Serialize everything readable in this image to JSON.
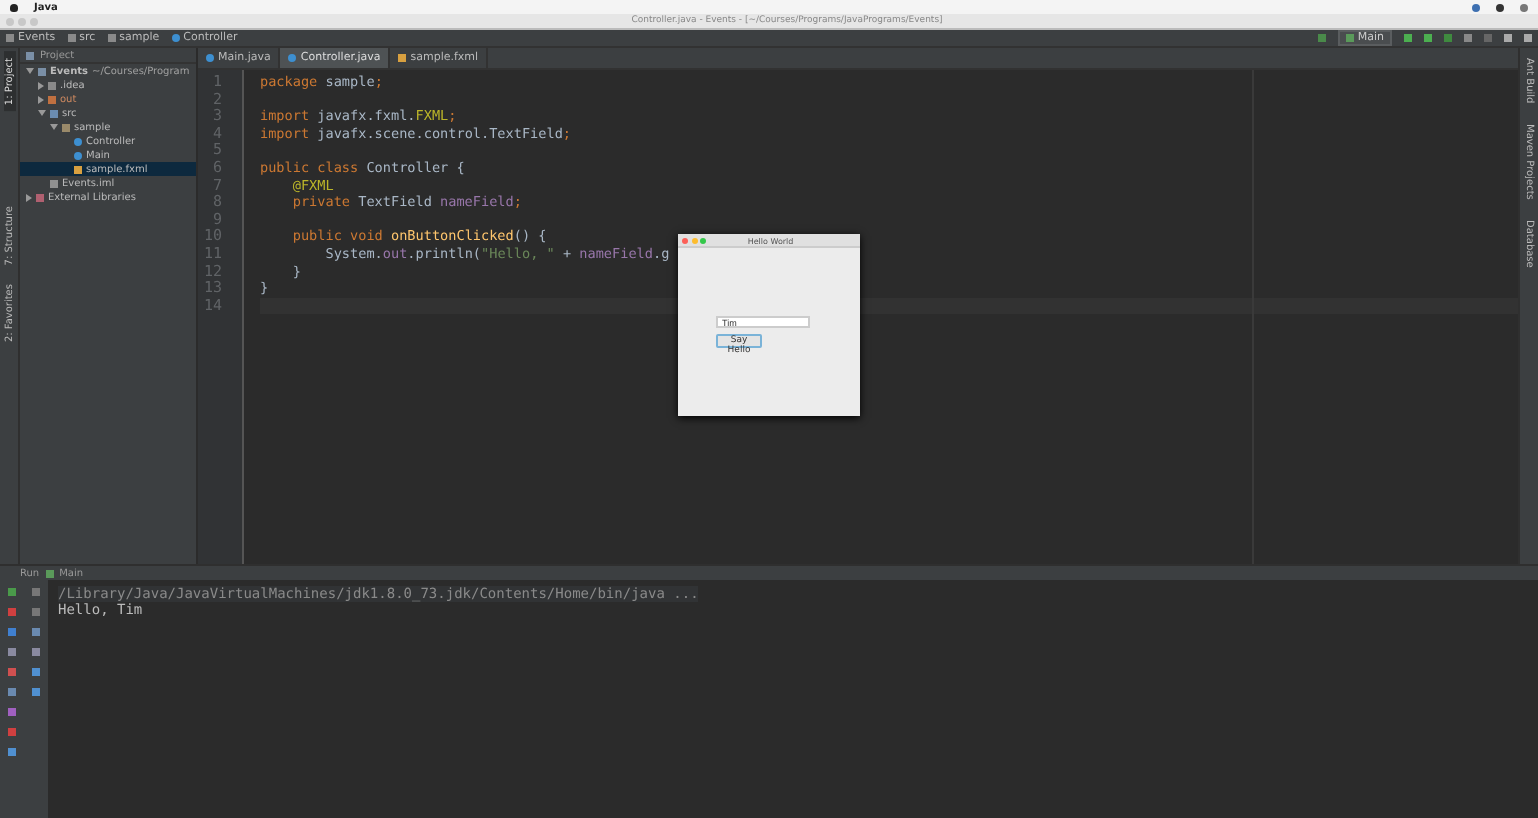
{
  "menu_bar": {
    "app": "Java"
  },
  "window": {
    "title": "Controller.java - Events - [~/Courses/Programs/JavaPrograms/Events]"
  },
  "breadcrumbs": [
    "Events",
    "src",
    "sample",
    "Controller"
  ],
  "run_config": "Main",
  "left_stripe": [
    {
      "label": "1: Project",
      "selected": true
    },
    {
      "label": "7: Structure",
      "selected": false
    },
    {
      "label": "2: Favorites",
      "selected": false
    }
  ],
  "right_stripe": [
    {
      "label": "Ant Build"
    },
    {
      "label": "Maven Projects"
    },
    {
      "label": "Database"
    }
  ],
  "project": {
    "title": "Project",
    "tree": [
      {
        "label": "Events",
        "path": "~/Courses/Program",
        "kind": "module",
        "expanded": true,
        "selected": false,
        "children": [
          {
            "label": ".idea",
            "kind": "folder",
            "expanded": false,
            "selected": false
          },
          {
            "label": "out",
            "kind": "excluded",
            "expanded": false,
            "selected": false
          },
          {
            "label": "src",
            "kind": "source",
            "expanded": true,
            "selected": false,
            "children": [
              {
                "label": "sample",
                "kind": "package",
                "expanded": true,
                "selected": false,
                "children": [
                  {
                    "label": "Controller",
                    "kind": "class",
                    "selected": false
                  },
                  {
                    "label": "Main",
                    "kind": "class",
                    "selected": false
                  },
                  {
                    "label": "sample.fxml",
                    "kind": "fxml",
                    "selected": true
                  }
                ]
              }
            ]
          },
          {
            "label": "Events.iml",
            "kind": "file",
            "selected": false
          }
        ]
      },
      {
        "label": "External Libraries",
        "kind": "library",
        "expanded": false,
        "selected": false
      }
    ]
  },
  "editor_tabs": [
    {
      "label": "Main.java",
      "kind": "class",
      "selected": false
    },
    {
      "label": "Controller.java",
      "kind": "class",
      "selected": true
    },
    {
      "label": "sample.fxml",
      "kind": "fxml",
      "selected": false
    }
  ],
  "code": [
    {
      "number": "1",
      "tokens": [
        {
          "text": "package ",
          "kind": "keyword"
        },
        {
          "text": "sample",
          "kind": "plain"
        },
        {
          "text": ";",
          "kind": "keyword"
        }
      ]
    },
    {
      "number": "2"
    },
    {
      "number": "3",
      "tokens": [
        {
          "text": "import ",
          "kind": "keyword"
        },
        {
          "text": "javafx.fxml.",
          "kind": "plain"
        },
        {
          "text": "FXML",
          "kind": "annotation"
        },
        {
          "text": ";",
          "kind": "keyword"
        }
      ]
    },
    {
      "number": "4",
      "tokens": [
        {
          "text": "import ",
          "kind": "keyword"
        },
        {
          "text": "javafx.scene.control.TextField",
          "kind": "plain"
        },
        {
          "text": ";",
          "kind": "keyword"
        }
      ]
    },
    {
      "number": "5"
    },
    {
      "number": "6",
      "tokens": [
        {
          "text": "public class ",
          "kind": "keyword"
        },
        {
          "text": "Controller {",
          "kind": "plain"
        }
      ]
    },
    {
      "number": "7",
      "tokens": [
        {
          "text": "    @FXML",
          "kind": "annotation"
        }
      ]
    },
    {
      "number": "8",
      "tokens": [
        {
          "text": "    private ",
          "kind": "keyword"
        },
        {
          "text": "TextField ",
          "kind": "plain"
        },
        {
          "text": "nameField",
          "kind": "field"
        },
        {
          "text": ";",
          "kind": "keyword"
        }
      ]
    },
    {
      "number": "9"
    },
    {
      "number": "10",
      "tokens": [
        {
          "text": "    public void ",
          "kind": "keyword"
        },
        {
          "text": "onButtonClicked",
          "kind": "method"
        },
        {
          "text": "() {",
          "kind": "plain"
        }
      ]
    },
    {
      "number": "11",
      "tokens": [
        {
          "text": "        System.",
          "kind": "plain"
        },
        {
          "text": "out",
          "kind": "field"
        },
        {
          "text": ".println(",
          "kind": "plain"
        },
        {
          "text": "\"Hello, \"",
          "kind": "string"
        },
        {
          "text": " + ",
          "kind": "plain"
        },
        {
          "text": "nameField",
          "kind": "field"
        },
        {
          "text": ".g",
          "kind": "plain"
        }
      ]
    },
    {
      "number": "12",
      "tokens": [
        {
          "text": "    }",
          "kind": "plain"
        }
      ]
    },
    {
      "number": "13",
      "tokens": [
        {
          "text": "}",
          "kind": "plain"
        }
      ]
    },
    {
      "number": "14"
    }
  ],
  "dialog": {
    "title": "Hello World",
    "field_value": "Tim",
    "button": "Say Hello"
  },
  "run_panel": {
    "label": "Run",
    "config": "Main",
    "output": [
      "/Library/Java/JavaVirtualMachines/jdk1.8.0_73.jdk/Contents/Home/bin/java ...",
      "Hello, Tim"
    ]
  }
}
